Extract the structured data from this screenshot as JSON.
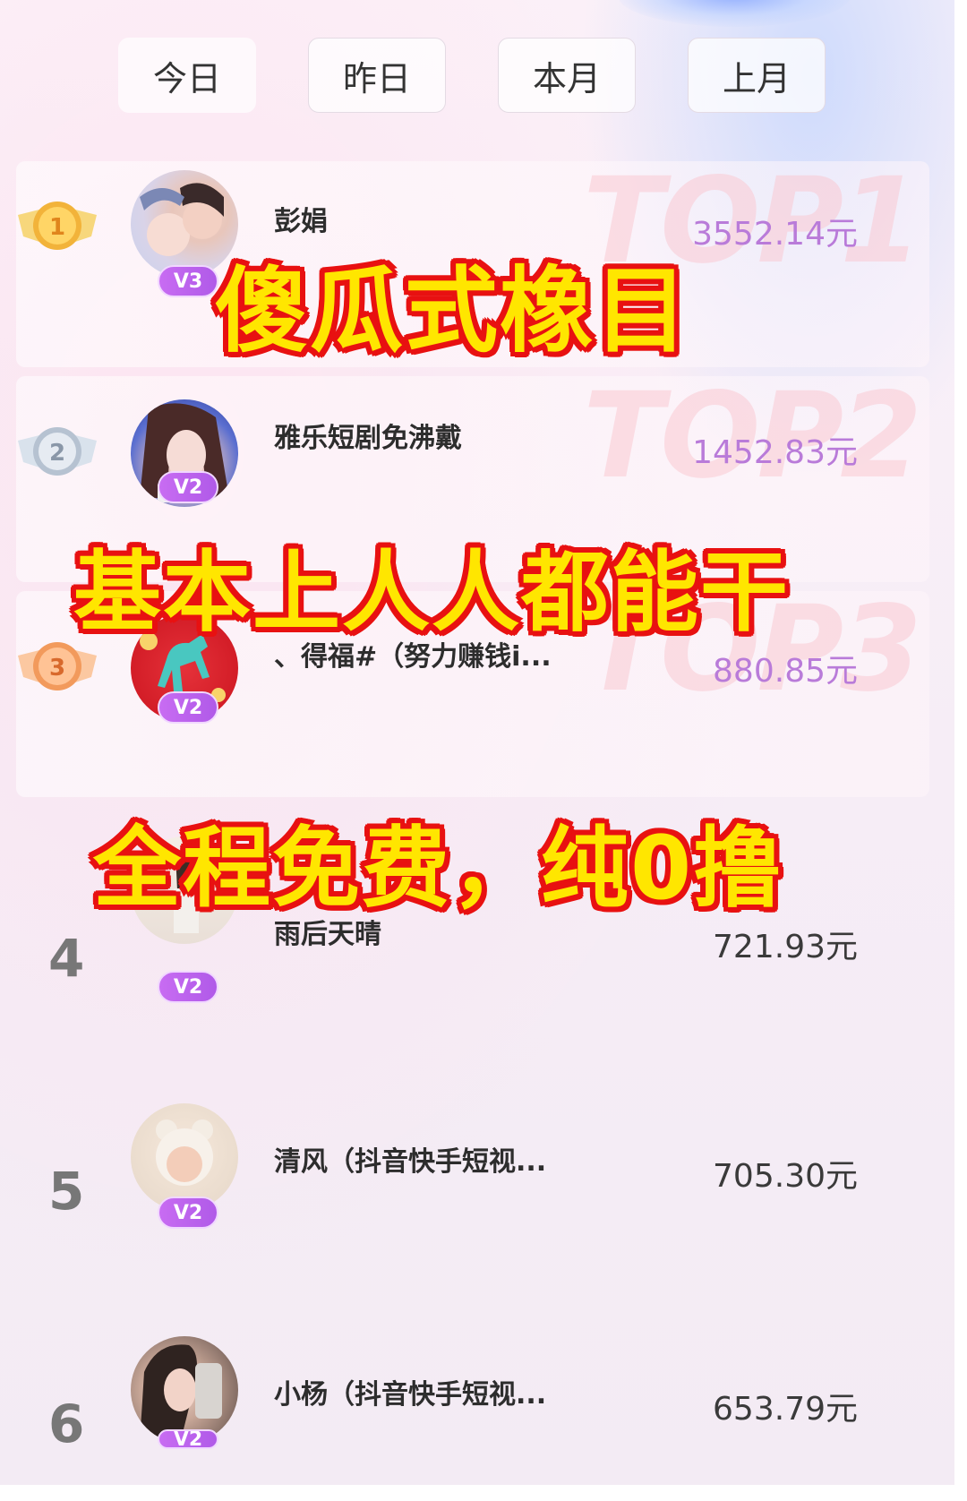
{
  "tabs": [
    {
      "label": "今日",
      "active": true
    },
    {
      "label": "昨日",
      "active": false
    },
    {
      "label": "本月",
      "active": false
    },
    {
      "label": "上月",
      "active": false
    }
  ],
  "ranking": [
    {
      "rank": "1",
      "medal": "gold-medal-icon",
      "name": "彭娟",
      "level": "V3",
      "amount": "3552.14元",
      "watermark": "TOP1"
    },
    {
      "rank": "2",
      "medal": "silver-medal-icon",
      "name": "雅乐短剧免沸戴",
      "level": "V2",
      "amount": "1452.83元",
      "watermark": "TOP2"
    },
    {
      "rank": "3",
      "medal": "bronze-medal-icon",
      "name": "、得福#（努力赚钱i...",
      "level": "V2",
      "amount": "880.85元",
      "watermark": "TOP3"
    },
    {
      "rank": "4",
      "name": "雨后天晴",
      "level": "V2",
      "amount": "721.93元"
    },
    {
      "rank": "5",
      "name": "清风（抖音快手短视...",
      "level": "V2",
      "amount": "705.30元"
    },
    {
      "rank": "6",
      "name": "小杨（抖音快手短视...",
      "level": "V2",
      "amount": "653.79元"
    }
  ],
  "overlay": {
    "line1": "傻瓜式橡目",
    "line2": "基本上人人都能干",
    "line3": "全程免费，纯0撸"
  },
  "colors": {
    "caption_fill": "#ffe600",
    "caption_stroke": "#e81111",
    "badge": "#b05ae8",
    "top_amount": "#b97bd9"
  }
}
